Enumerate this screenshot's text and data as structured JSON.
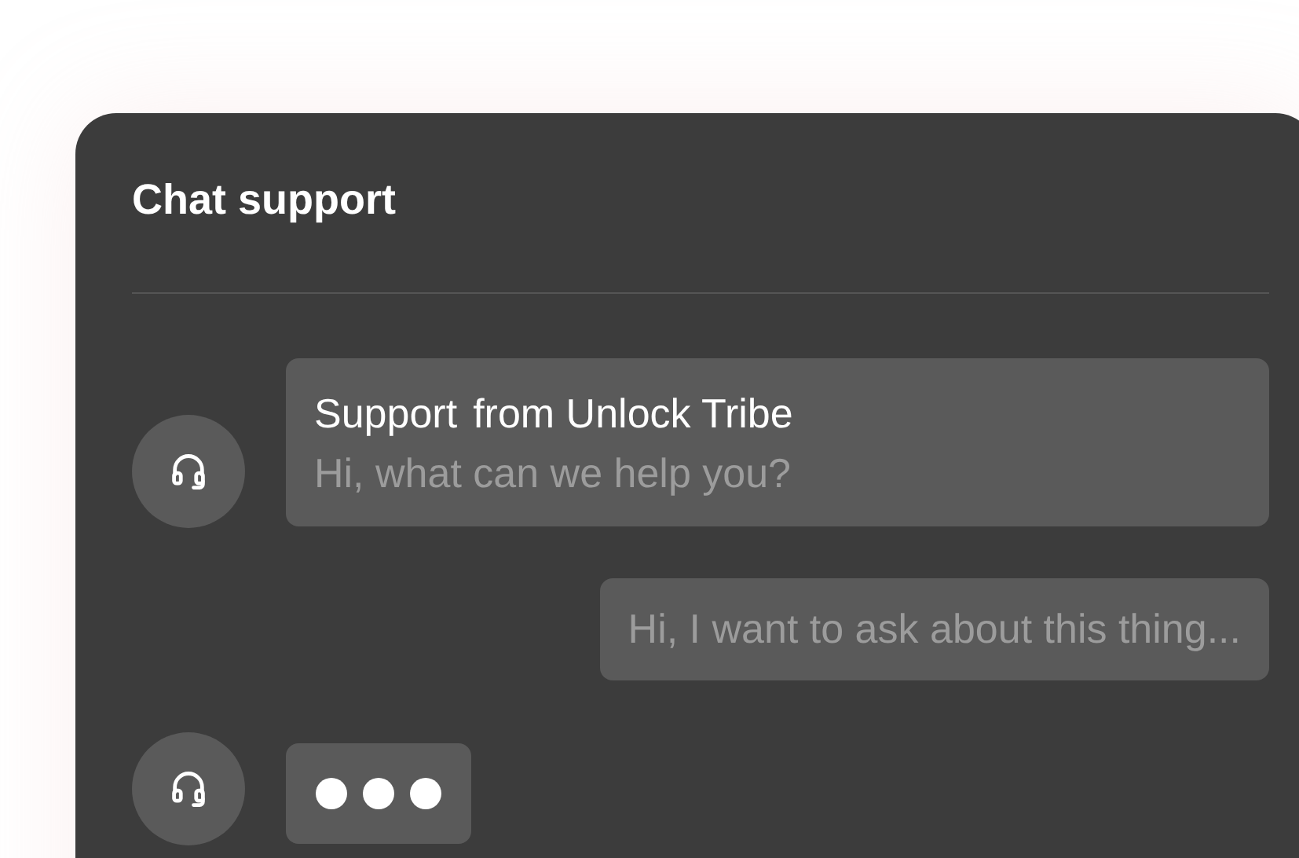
{
  "panel": {
    "title": "Chat support"
  },
  "messages": [
    {
      "kind": "agent",
      "sender": "Support",
      "sender_note": "from Unlock Tribe",
      "text": "Hi, what can we help you?"
    },
    {
      "kind": "user",
      "text": "Hi, I want to ask about this thing..."
    },
    {
      "kind": "typing"
    }
  ]
}
